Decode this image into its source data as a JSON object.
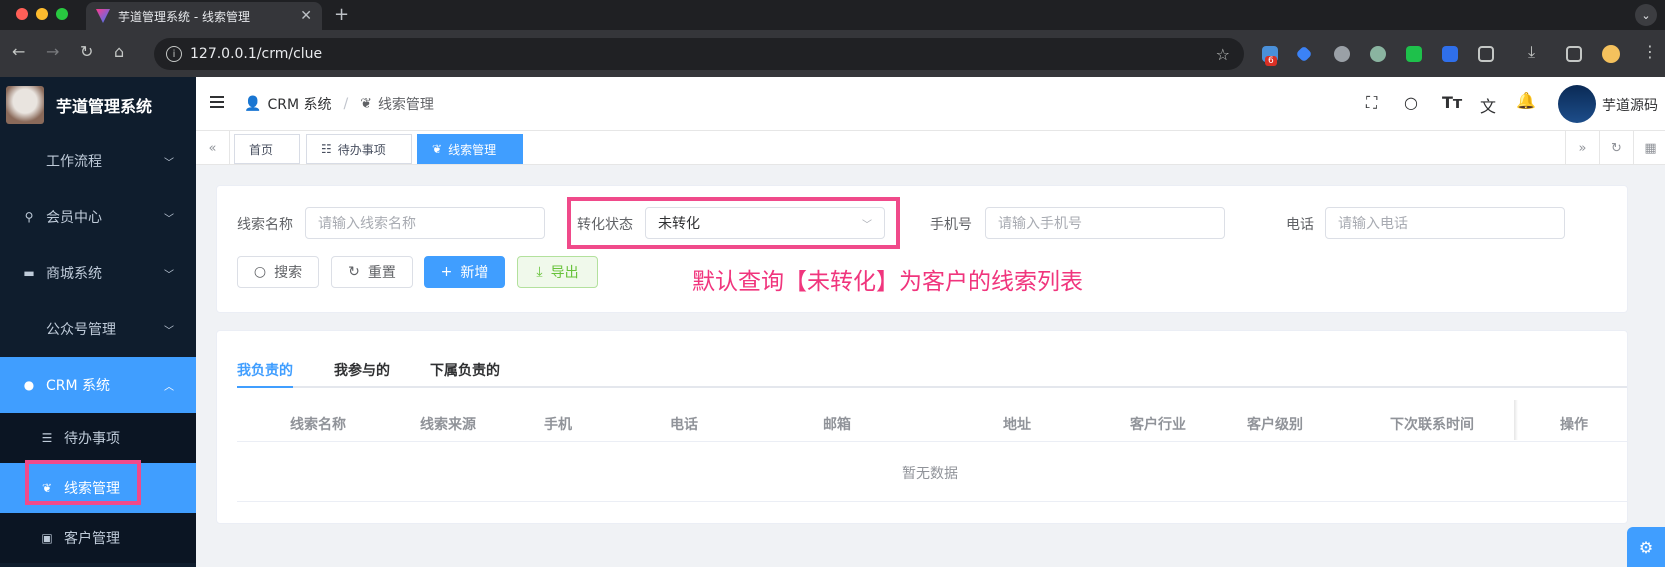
{
  "browser": {
    "tab_title": "芋道管理系统 - 线索管理",
    "tab_close": "✕",
    "new_tab": "+",
    "url": "127.0.0.1/crm/clue",
    "ext_badge": "6"
  },
  "sidebar": {
    "app_title": "芋道管理系统",
    "items": [
      {
        "label": "工作流程"
      },
      {
        "label": "会员中心"
      },
      {
        "label": "商城系统"
      },
      {
        "label": "公众号管理"
      },
      {
        "label": "CRM 系统"
      }
    ],
    "sub_items": [
      {
        "label": "待办事项"
      },
      {
        "label": "线索管理"
      },
      {
        "label": "客户管理"
      }
    ]
  },
  "navbar": {
    "breadcrumb_root": "CRM 系统",
    "breadcrumb_sep": "/",
    "breadcrumb_current": "线索管理",
    "user_name": "芋道源码"
  },
  "tags": [
    {
      "label": "首页"
    },
    {
      "label": "待办事项"
    },
    {
      "label": "线索管理"
    }
  ],
  "search": {
    "name_label": "线索名称",
    "name_placeholder": "请输入线索名称",
    "status_label": "转化状态",
    "status_value": "未转化",
    "mobile_label": "手机号",
    "mobile_placeholder": "请输入手机号",
    "phone_label": "电话",
    "phone_placeholder": "请输入电话",
    "btn_search": "搜索",
    "btn_reset": "重置",
    "btn_add": "新增",
    "btn_export": "导出"
  },
  "annotation": "默认查询【未转化】为客户的线索列表",
  "list": {
    "tabs": [
      {
        "label": "我负责的"
      },
      {
        "label": "我参与的"
      },
      {
        "label": "下属负责的"
      }
    ],
    "columns": [
      "线索名称",
      "线索来源",
      "手机",
      "电话",
      "邮箱",
      "地址",
      "客户行业",
      "客户级别",
      "下次联系时间",
      "操作"
    ],
    "empty_text": "暂无数据"
  },
  "colors": {
    "primary": "#409eff",
    "sidebar_bg": "#0f1d2d",
    "highlight": "#f04a8a"
  }
}
